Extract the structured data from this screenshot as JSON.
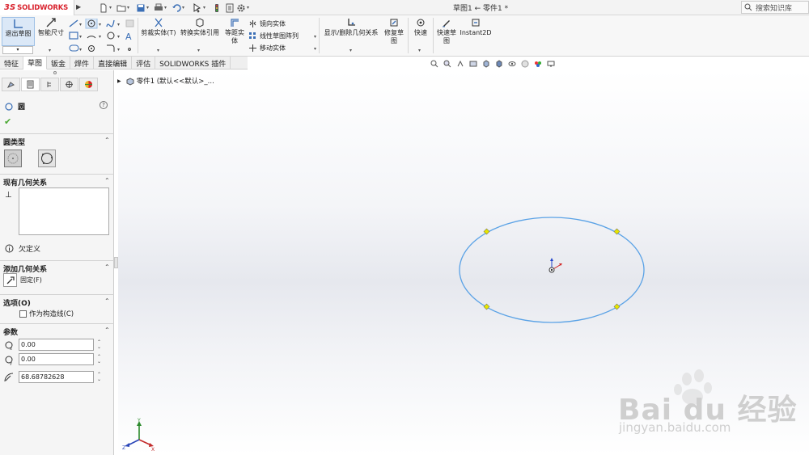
{
  "app": {
    "logo_prefix": "3S",
    "logo_name": "SOLIDWORKS",
    "doc_title": "草图1 ← 零件1 *",
    "search_placeholder": "搜索知识库"
  },
  "ribbon": {
    "exit_sketch": "退出草图",
    "smart_dimension": "智能尺寸",
    "trim": "剪裁实体(T)",
    "convert": "转换实体引用",
    "offset_line1": "等距实",
    "offset_line2": "体",
    "mirror": "镜向实体",
    "linear_pattern": "线性草图阵列",
    "move": "移动实体",
    "display_relations": "显示/删除几何关系",
    "repair_line1": "修复草",
    "repair_line2": "图",
    "quick_snaps": "快速",
    "rapid_sketch_line1": "快速草",
    "rapid_sketch_line2": "图",
    "instant2d": "Instant2D"
  },
  "tabs": [
    {
      "label": "特征"
    },
    {
      "label": "草图"
    },
    {
      "label": "钣金"
    },
    {
      "label": "焊件"
    },
    {
      "label": "直接编辑"
    },
    {
      "label": "评估"
    },
    {
      "label": "SOLIDWORKS 插件"
    }
  ],
  "property_manager": {
    "title": "圆",
    "help": "?",
    "circle_type": "圆类型",
    "existing_relations": "现有几何关系",
    "status": "欠定义",
    "add_relations": "添加几何关系",
    "fix_label": "固定(F)",
    "options": "选项(O)",
    "construction_label": "作为构造线(C)",
    "parameters": "参数",
    "center_x": "0.00",
    "center_y": "0.00",
    "radius": "68.68782628"
  },
  "tree": {
    "root_label": "零件1 (默认<<默认>_..."
  },
  "colors": {
    "sketch_line": "#5aa2e6",
    "accent_red": "#d9232e",
    "endpoint": "#e6e600"
  },
  "watermark": {
    "brand": "Bai du 经验",
    "url": "jingyan.baidu.com"
  },
  "triad": {
    "x": "X",
    "y": "Y",
    "z": "Z"
  }
}
